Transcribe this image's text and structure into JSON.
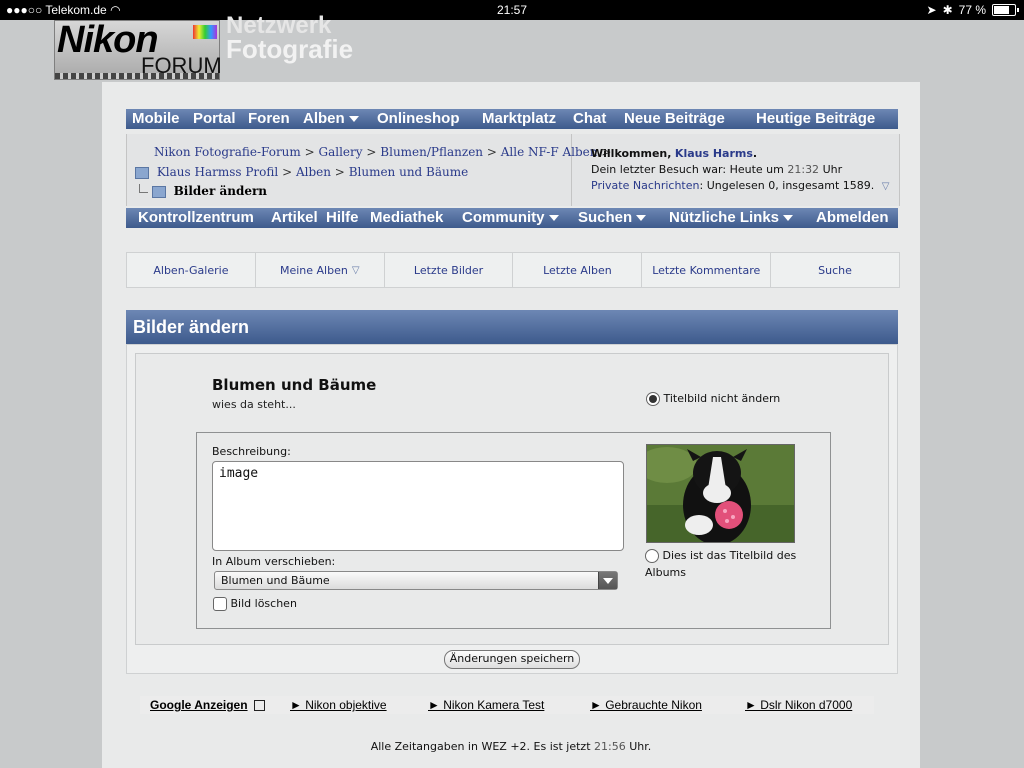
{
  "statusbar": {
    "carrier": "●●●○○ Telekom.de",
    "wifi_icon": "wifi-icon",
    "time": "21:57",
    "battery": "77 %",
    "battery_level": 0.77
  },
  "header": {
    "logo_text": "Nikon",
    "logo_sub": "FORUM",
    "brand_top": "Netzwerk",
    "brand": "Fotografie"
  },
  "top_nav": [
    "Mobile",
    "Portal",
    "Foren",
    "Alben",
    "Onlineshop",
    "Marktplatz",
    "Chat",
    "Neue Beiträge",
    "Heutige Beiträge"
  ],
  "breadcrumbs": {
    "line1": [
      "Nikon Fotografie-Forum",
      "Gallery",
      "Blumen/Pflanzen",
      "Alle NF-F Alben"
    ],
    "line2": [
      "Klaus Harmss Profil",
      "Alben",
      "Blumen und Bäume"
    ],
    "current": "Bilder ändern"
  },
  "welcome": {
    "greeting": "Willkommen,",
    "user": "Klaus Harms",
    "last_visit_label": "Dein letzter Besuch war: Heute um",
    "last_visit_time": "21:32",
    "last_visit_suffix": "Uhr",
    "pm_label": "Private Nachrichten",
    "pm_text": ": Ungelesen 0, insgesamt 1589."
  },
  "second_nav": [
    "Kontrollzentrum",
    "Artikel",
    "Hilfe",
    "Mediathek",
    "Community",
    "Suchen",
    "Nützliche Links",
    "Abmelden"
  ],
  "sub_nav": [
    "Alben-Galerie",
    "Meine Alben",
    "Letzte Bilder",
    "Letzte Alben",
    "Letzte Kommentare",
    "Suche"
  ],
  "panel": {
    "title": "Bilder ändern",
    "album_title": "Blumen und Bäume",
    "album_desc": "wies da steht...",
    "keep_cover_label": "Titelbild nicht ändern",
    "description_label": "Beschreibung:",
    "description_value": "image",
    "move_label": "In Album verschieben:",
    "move_value": "Blumen und Bäume",
    "delete_label": "Bild löschen",
    "cover_label": "Dies ist das Titelbild des Albums",
    "save_label": "Änderungen speichern"
  },
  "ads": {
    "label": "Google Anzeigen",
    "links": [
      "► Nikon objektive",
      "► Nikon Kamera Test",
      "► Gebrauchte Nikon",
      "► Dslr Nikon d7000"
    ]
  },
  "footer": {
    "prefix": "Alle Zeitangaben in WEZ +2. Es ist jetzt",
    "time": "21:56",
    "suffix": "Uhr."
  },
  "colors": {
    "nav_top": "#6d87b4",
    "nav_bottom": "#3d5a8c",
    "link": "#2a3a8a",
    "page_bg": "#c8cacb"
  }
}
